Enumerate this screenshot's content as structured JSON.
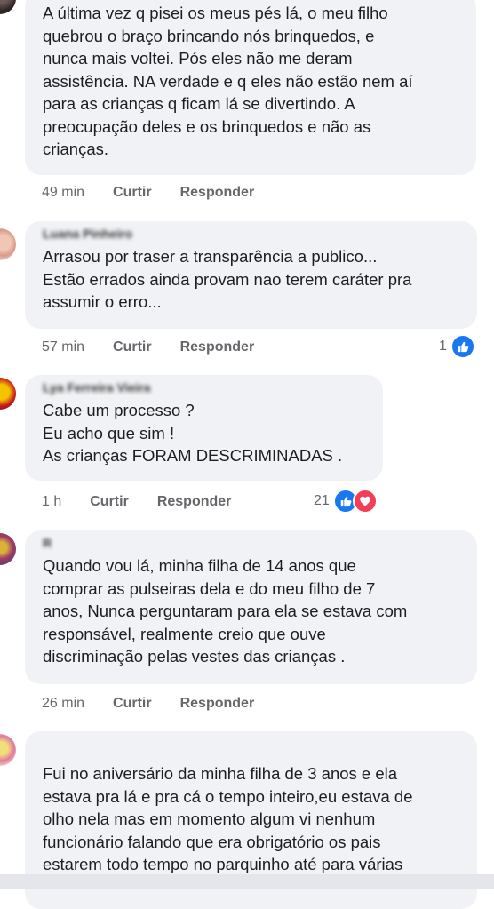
{
  "comments": [
    {
      "author": "",
      "text": "A última vez q pisei os meus pés lá, o meu filho\nquebrou o braço brincando nós brinquedos, e\nnunca mais voltei. Pós eles não me deram\nassistência. NA verdade e q eles não estão nem aí\npara as crianças q ficam lá se divertindo. A\npreocupação deles e os brinquedos e não as\ncrianças.",
      "time": "49 min",
      "like_label": "Curtir",
      "reply_label": "Responder"
    },
    {
      "author": "Luana Pinheiro",
      "text": "Arrasou por traser a transparência a publico...\nEstão errados ainda provam nao terem caráter pra\nassumir o erro...",
      "time": "57 min",
      "like_label": "Curtir",
      "reply_label": "Responder",
      "reaction_count": "1"
    },
    {
      "author": "Lya Ferreira Vieira",
      "text": "Cabe um processo ?\nEu acho que sim !\nAs crianças FORAM DESCRIMINADAS .",
      "time": "1 h",
      "like_label": "Curtir",
      "reply_label": "Responder",
      "reaction_count": "21"
    },
    {
      "author": "R",
      "text": "Quando vou lá, minha filha de 14 anos que\ncomprar as pulseiras dela e do meu filho de 7\nanos, Nunca perguntaram para ela se estava com\nresponsável, realmente creio que ouve\ndiscriminação pelas vestes das crianças .",
      "time": "26 min",
      "like_label": "Curtir",
      "reply_label": "Responder"
    },
    {
      "author": "",
      "text": "Fui no aniversário da minha filha de 3 anos e ela\nestava pra lá e pra cá o tempo inteiro,eu estava de\nolho nela mas em momento algum vi nenhum\nfuncionário falando que era obrigatório os pais\nestarem todo tempo no parquinho até para várias"
    }
  ],
  "colors": {
    "bubble": "#f0f2f5",
    "text": "#1c1e21",
    "meta": "#65676b",
    "like": "#1877f2",
    "love": "#f33e58"
  },
  "icons": [
    "like-icon",
    "love-icon",
    "avatar"
  ]
}
